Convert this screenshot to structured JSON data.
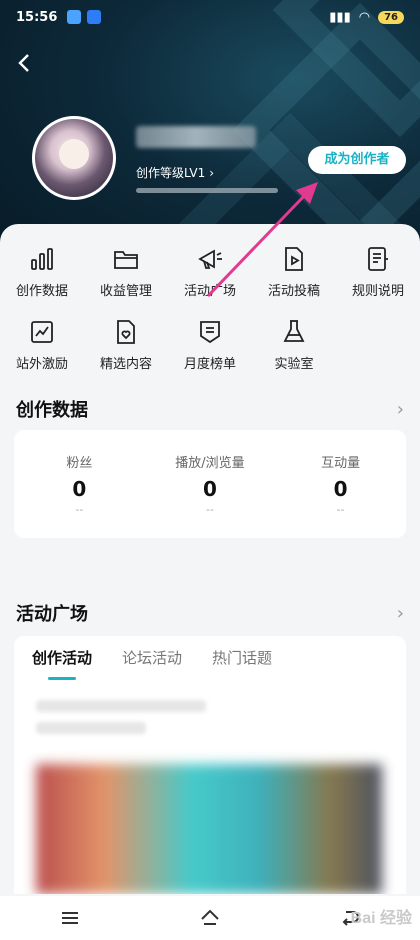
{
  "status_bar": {
    "time": "15:56",
    "battery": "76"
  },
  "header": {
    "level_text": "创作等级LV1",
    "become_creator_label": "成为创作者"
  },
  "grid": {
    "items": [
      {
        "label": "创作数据",
        "icon": "bar-chart-icon"
      },
      {
        "label": "收益管理",
        "icon": "folder-icon"
      },
      {
        "label": "活动广场",
        "icon": "megaphone-icon"
      },
      {
        "label": "活动投稿",
        "icon": "video-doc-icon"
      },
      {
        "label": "规则说明",
        "icon": "rules-doc-icon"
      },
      {
        "label": "站外激励",
        "icon": "trend-icon"
      },
      {
        "label": "精选内容",
        "icon": "doc-heart-icon"
      },
      {
        "label": "月度榜单",
        "icon": "ranking-badge-icon"
      },
      {
        "label": "实验室",
        "icon": "flask-icon"
      }
    ]
  },
  "creation_data": {
    "title": "创作数据",
    "stats": [
      {
        "label": "粉丝",
        "value": "0",
        "diff": "--"
      },
      {
        "label": "播放/浏览量",
        "value": "0",
        "diff": "--"
      },
      {
        "label": "互动量",
        "value": "0",
        "diff": "--"
      }
    ]
  },
  "activity": {
    "title": "活动广场",
    "tabs": [
      "创作活动",
      "论坛活动",
      "热门话题"
    ]
  },
  "watermark": "Bai 经验",
  "colors": {
    "accent": "#19b3c4",
    "arrow": "#e23a8f"
  }
}
